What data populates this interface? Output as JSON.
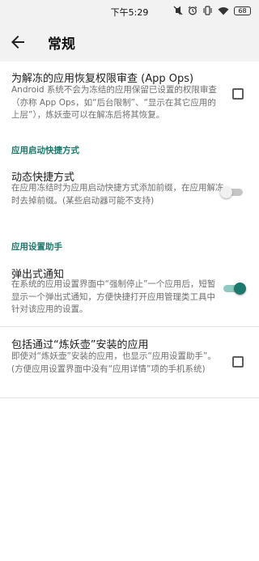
{
  "status_bar": {
    "time": "下午5:29",
    "battery": "68",
    "icons": [
      "mute-icon",
      "alarm-icon",
      "vibrate-icon",
      "wifi-icon",
      "battery-icon"
    ]
  },
  "app_bar": {
    "title": "常规",
    "back_icon": "arrow-back-icon"
  },
  "items": {
    "review_permissions": {
      "title": "为解冻的应用恢复权限审查 (App Ops)",
      "summary": "Android 系统不会为冻结的应用保留已设置的权限审查（亦称 App Ops，如“后台限制”、“显示在其它应用的上层”），炼妖壶可以在解冻后将其恢复。",
      "checked": false
    },
    "dynamic_shortcuts": {
      "title": "动态快捷方式",
      "summary": "在应用冻结时为应用启动快捷方式添加前缀，在应用解冻时去掉前缀。(某些启动器可能不支持)",
      "enabled": false
    },
    "popup_notification": {
      "title": "弹出式通知",
      "summary": "在系统的应用设置界面中“强制停止”一个应用后，短暂显示一个弹出式通知，方便快捷打开应用管理类工具中针对该应用的设置。",
      "enabled": true
    },
    "include_installed": {
      "title": "包括通过“炼妖壶”安装的应用",
      "summary": "即使对“炼妖壶”安装的应用，也显示“应用设置助手”。(方便应用设置界面中没有“应用详情”项的手机系统)",
      "checked": false
    }
  },
  "sections": {
    "shortcuts_header": "应用启动快捷方式",
    "settings_helper_header": "应用设置助手"
  },
  "colors": {
    "accent": "#1b7a6c",
    "bar_background": "#f2f2f2",
    "summary_text": "#6f6f6f"
  }
}
